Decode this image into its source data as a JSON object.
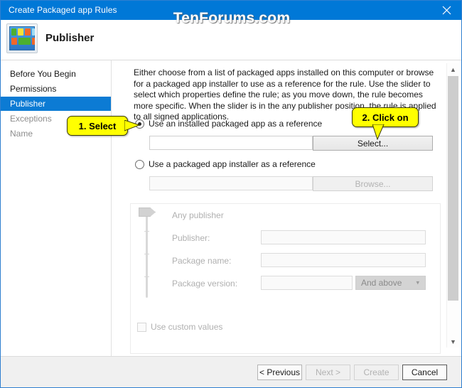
{
  "window": {
    "title": "Create Packaged app Rules",
    "close_icon": "close-icon",
    "watermark": "TenForums.com"
  },
  "header": {
    "title": "Publisher",
    "icon": "packaged-app-icon"
  },
  "sidebar": {
    "items": [
      {
        "label": "Before You Begin",
        "state": "normal"
      },
      {
        "label": "Permissions",
        "state": "normal"
      },
      {
        "label": "Publisher",
        "state": "selected"
      },
      {
        "label": "Exceptions",
        "state": "disabled"
      },
      {
        "label": "Name",
        "state": "disabled"
      }
    ]
  },
  "main": {
    "intro": "Either choose from a list of packaged apps installed on this computer or browse for a packaged app installer to use as a reference for the rule. Use the slider to select which properties define the rule; as you move down, the rule becomes more specific. When the slider is in the any publisher position, the rule is applied to all signed applications.",
    "radio_installed_app": {
      "label": "Use an installed packaged app as a reference",
      "checked": true
    },
    "installed_app_textbox": {
      "value": "",
      "placeholder": ""
    },
    "select_button": {
      "label": "Select...",
      "enabled": true
    },
    "radio_app_installer": {
      "label": "Use a packaged app installer as a reference",
      "checked": false
    },
    "app_installer_textbox": {
      "value": "",
      "placeholder": ""
    },
    "browse_button": {
      "label": "Browse...",
      "enabled": false
    },
    "slider": {
      "any_publisher_label": "Any publisher",
      "rows": [
        {
          "label": "Publisher:",
          "value": ""
        },
        {
          "label": "Package name:",
          "value": ""
        },
        {
          "label": "Package version:",
          "value": ""
        }
      ],
      "version_condition": "And above"
    },
    "use_custom_values": {
      "label": "Use custom values",
      "checked": false
    }
  },
  "scrollbar": {
    "up_icon": "chevron-up-icon",
    "down_icon": "chevron-down-icon"
  },
  "footer": {
    "previous": {
      "label": "< Previous",
      "enabled": true
    },
    "next": {
      "label": "Next >",
      "enabled": false
    },
    "create": {
      "label": "Create",
      "enabled": false
    },
    "cancel": {
      "label": "Cancel",
      "enabled": true
    }
  },
  "callouts": [
    {
      "label": "1. Select"
    },
    {
      "label": "2. Click on"
    }
  ],
  "colors": {
    "titlebar": "#0078d7",
    "selection": "#0c7bd4",
    "callout": "#ffff00"
  }
}
